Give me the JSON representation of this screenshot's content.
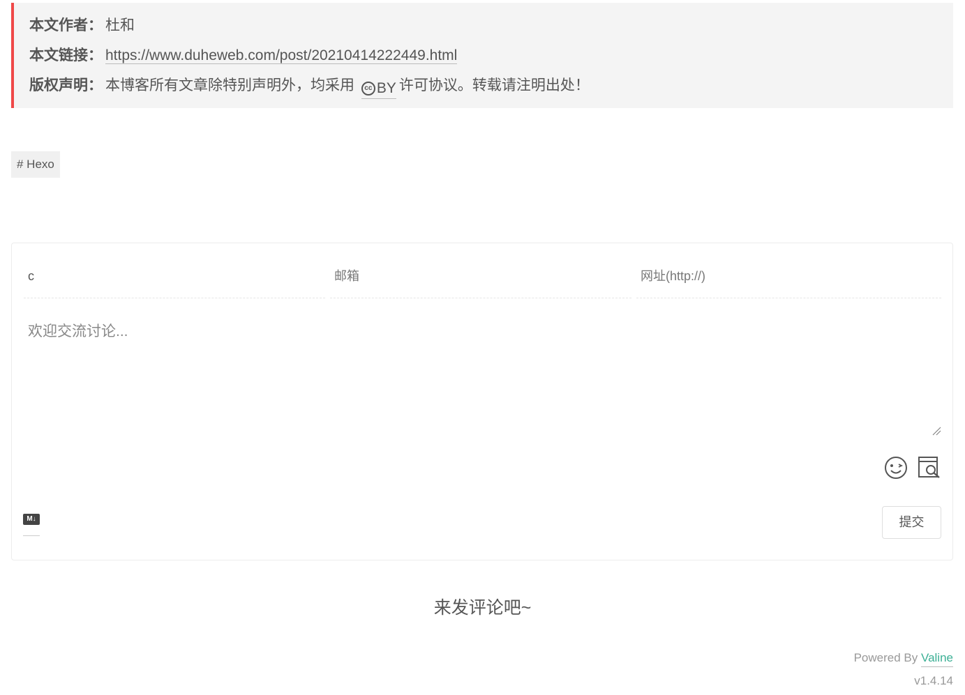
{
  "copyright": {
    "author_label": "本文作者：",
    "author_value": "杜和",
    "link_label": "本文链接：",
    "link_value": "https://www.duheweb.com/post/20210414222449.html",
    "license_label": "版权声明：",
    "license_before": "本博客所有文章除特别声明外，均采用",
    "license_cc_text": "cc",
    "license_badge": "BY",
    "license_after": "许可协议。转载请注明出处！",
    "accent_color": "#ef4848"
  },
  "tag": {
    "label": "# Hexo"
  },
  "comment_form": {
    "nick_value": "c",
    "email_placeholder": "邮箱",
    "url_placeholder": "网址(http://)",
    "content_placeholder": "欢迎交流讨论...",
    "markdown_label": "M↓",
    "submit_label": "提交",
    "emoji_icon": "emoji-icon",
    "preview_icon": "preview-icon"
  },
  "comments": {
    "empty_text": "来发评论吧~"
  },
  "footer": {
    "powered_by": "Powered By",
    "powered_link": "Valine",
    "powered_link_color": "#3cb095",
    "version": "v1.4.14"
  }
}
